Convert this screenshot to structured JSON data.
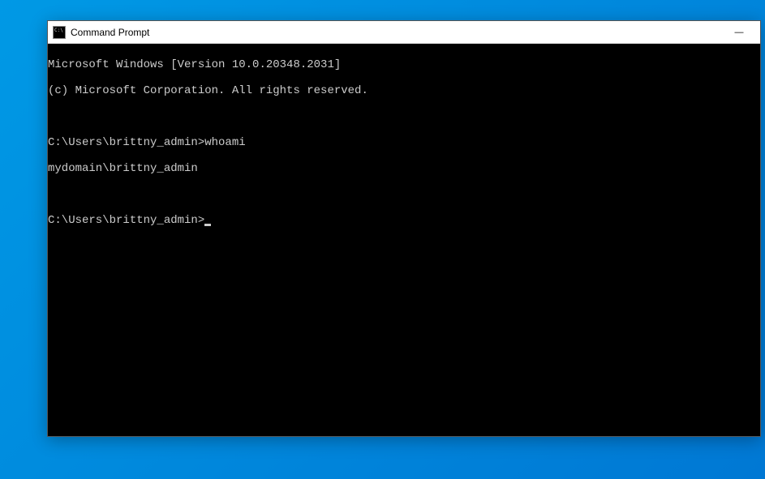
{
  "window": {
    "title": "Command Prompt",
    "controls": {
      "minimize": "—"
    }
  },
  "terminal": {
    "lines": [
      "Microsoft Windows [Version 10.0.20348.2031]",
      "(c) Microsoft Corporation. All rights reserved.",
      "",
      "C:\\Users\\brittny_admin>whoami",
      "mydomain\\brittny_admin",
      ""
    ],
    "prompt": "C:\\Users\\brittny_admin>"
  }
}
